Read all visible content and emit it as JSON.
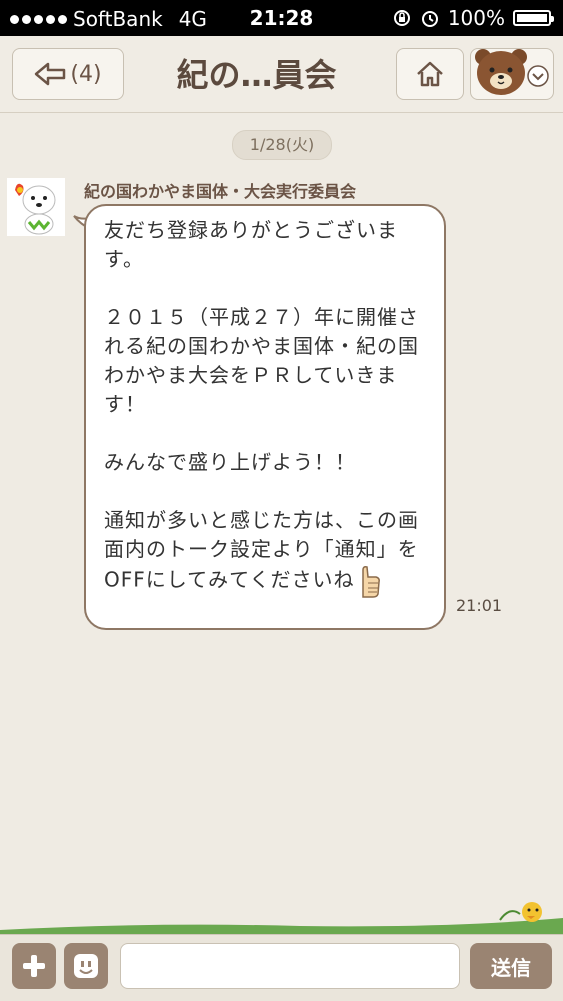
{
  "status_bar": {
    "carrier": "SoftBank",
    "network": "4G",
    "time": "21:28",
    "battery": "100%"
  },
  "header": {
    "back_count": "(4)",
    "title": "紀の…員会"
  },
  "chat": {
    "date": "1/28(火)",
    "messages": [
      {
        "sender": "紀の国わかやま国体・大会実行委員会",
        "text": "友だち登録ありがとうございます。\n\n２０１５（平成２７）年に開催される紀の国わかやま国体・紀の国わかやま大会をＰＲしていきます！\n\nみんなで盛り上げよう！！\n\n通知が多いと感じた方は、この画面内のトーク設定より「通知」をOFFにしてみてくださいね",
        "time": "21:01"
      }
    ]
  },
  "input_bar": {
    "placeholder": "",
    "send_label": "送信"
  },
  "colors": {
    "background": "#efebe3",
    "accent_brown": "#9a8472",
    "text_brown": "#6b5446"
  }
}
